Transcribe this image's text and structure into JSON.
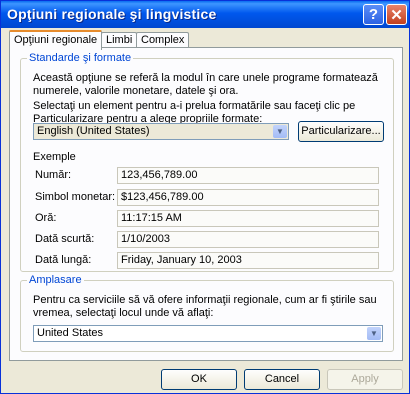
{
  "window": {
    "title": "Opţiuni regionale şi lingvistice",
    "help_glyph": "?",
    "close_glyph": "✕"
  },
  "tabs": [
    {
      "label": "Opţiuni regionale"
    },
    {
      "label": "Limbi"
    },
    {
      "label": "Complex"
    }
  ],
  "formats": {
    "legend": "Standarde şi formate",
    "description": "Această opţiune se referă la modul în care unele programe formatează numerele, valorile monetare, datele şi ora.",
    "instruction": "Selectaţi un element pentru a-i prelua formatările sau faceţi clic pe Particularizare pentru a alege propriile formate:",
    "locale_value": "English (United States)",
    "customize_label": "Particularizare...",
    "examples_label": "Exemple",
    "examples": [
      {
        "label": "Număr:",
        "value": "123,456,789.00"
      },
      {
        "label": "Simbol monetar:",
        "value": "$123,456,789.00"
      },
      {
        "label": "Oră:",
        "value": "11:17:15 AM"
      },
      {
        "label": "Dată scurtă:",
        "value": "1/10/2003"
      },
      {
        "label": "Dată lungă:",
        "value": "Friday, January 10, 2003"
      }
    ]
  },
  "location": {
    "legend": "Amplasare",
    "description": "Pentru ca serviciile să vă ofere informaţii regionale, cum ar fi ştirile sau vremea, selectaţi locul unde vă aflaţi:",
    "value": "United States"
  },
  "footer": {
    "ok": "OK",
    "cancel": "Cancel",
    "apply": "Apply"
  }
}
